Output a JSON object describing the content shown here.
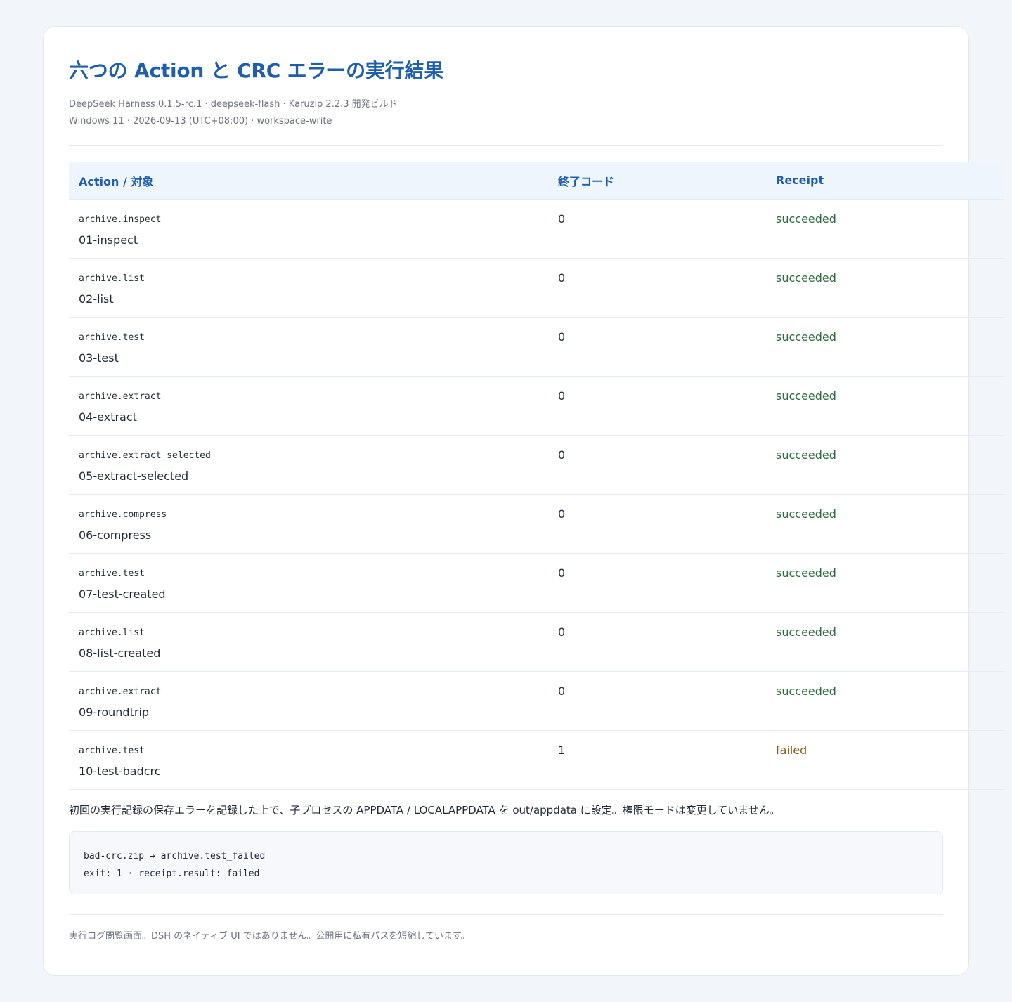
{
  "header": {
    "title": "六つの Action と CRC エラーの実行結果",
    "meta_line1": "DeepSeek Harness 0.1.5-rc.1 · deepseek-flash · Karuzip 2.2.3 開発ビルド",
    "meta_line2": "Windows 11 · 2026-09-13 (UTC+08:00) · workspace-write"
  },
  "table": {
    "columns": [
      "Action / 対象",
      "終了コード",
      "Receipt"
    ],
    "rows": [
      {
        "action": "archive.inspect",
        "target": "01-inspect",
        "exit": "0",
        "receipt": "succeeded"
      },
      {
        "action": "archive.list",
        "target": "02-list",
        "exit": "0",
        "receipt": "succeeded"
      },
      {
        "action": "archive.test",
        "target": "03-test",
        "exit": "0",
        "receipt": "succeeded"
      },
      {
        "action": "archive.extract",
        "target": "04-extract",
        "exit": "0",
        "receipt": "succeeded"
      },
      {
        "action": "archive.extract_selected",
        "target": "05-extract-selected",
        "exit": "0",
        "receipt": "succeeded"
      },
      {
        "action": "archive.compress",
        "target": "06-compress",
        "exit": "0",
        "receipt": "succeeded"
      },
      {
        "action": "archive.test",
        "target": "07-test-created",
        "exit": "0",
        "receipt": "succeeded"
      },
      {
        "action": "archive.list",
        "target": "08-list-created",
        "exit": "0",
        "receipt": "succeeded"
      },
      {
        "action": "archive.extract",
        "target": "09-roundtrip",
        "exit": "0",
        "receipt": "succeeded"
      },
      {
        "action": "archive.test",
        "target": "10-test-badcrc",
        "exit": "1",
        "receipt": "failed"
      }
    ]
  },
  "note": "初回の実行記録の保存エラーを記録した上で、子プロセスの APPDATA / LOCALAPPDATA を out/appdata に設定。権限モードは変更していません。",
  "code": {
    "line1": "bad-crc.zip → archive.test_failed",
    "line2": "exit: 1 · receipt.result: failed"
  },
  "footer": "実行ログ閲覧画面。DSH のネイティブ UI ではありません。公開用に私有パスを短縮しています。",
  "colors": {
    "accent": "#1f5ea8",
    "success": "#2e6b3e",
    "failure": "#8a5a1f"
  }
}
